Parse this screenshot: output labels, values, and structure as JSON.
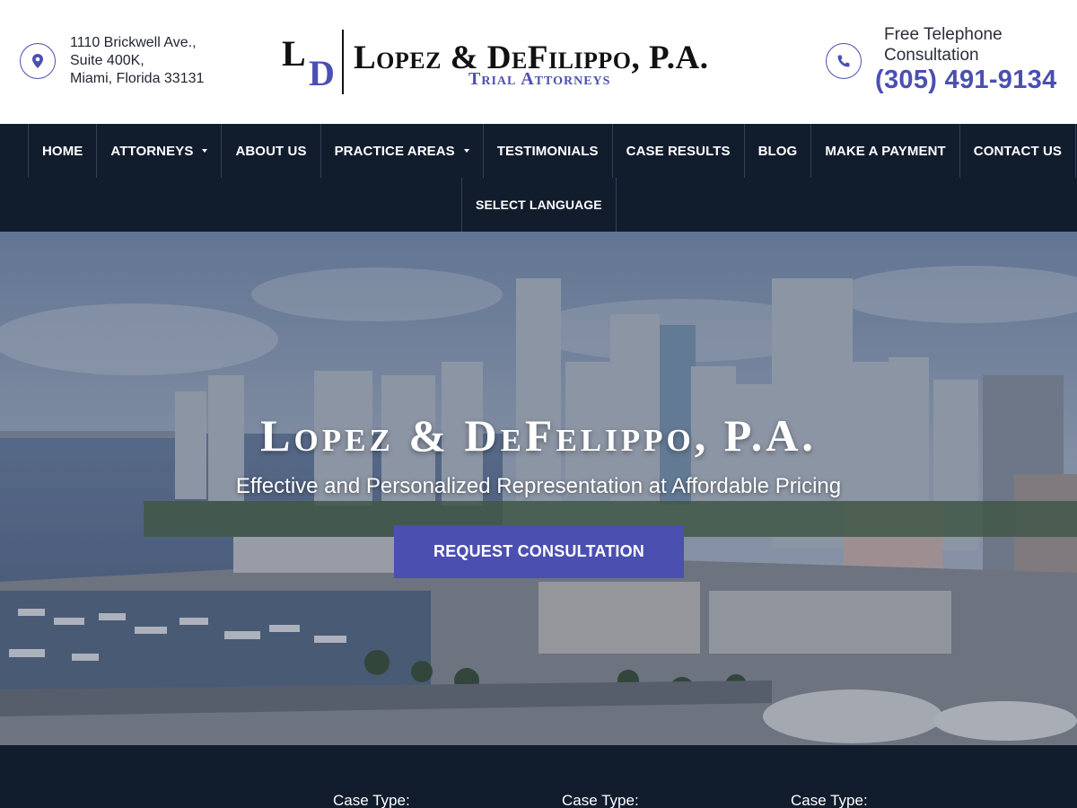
{
  "header": {
    "address": {
      "line1": "1110 Brickwell Ave.,",
      "line2": "Suite 400K,",
      "line3": "Miami, Florida 33131",
      "icon": "location-pin-icon"
    },
    "logo": {
      "monogram_l": "L",
      "monogram_d": "D",
      "name": "Lopez & DeFilippo, P.A.",
      "subtitle": "Trial Attorneys"
    },
    "consultation": {
      "label_line1": "Free Telephone",
      "label_line2": "Consultation",
      "phone": "(305) 491-9134",
      "icon": "phone-icon"
    }
  },
  "nav": {
    "items": [
      {
        "label": "HOME",
        "dropdown": false
      },
      {
        "label": "ATTORNEYS",
        "dropdown": true
      },
      {
        "label": "ABOUT US",
        "dropdown": false
      },
      {
        "label": "PRACTICE AREAS",
        "dropdown": true
      },
      {
        "label": "TESTIMONIALS",
        "dropdown": false
      },
      {
        "label": "CASE RESULTS",
        "dropdown": false
      },
      {
        "label": "BLOG",
        "dropdown": false
      },
      {
        "label": "MAKE A PAYMENT",
        "dropdown": false
      },
      {
        "label": "CONTACT US",
        "dropdown": false
      }
    ],
    "language": "SELECT LANGUAGE"
  },
  "hero": {
    "title": "Lopez & DeFelippo, P.A.",
    "tagline": "Effective and Personalized Representation at Affordable Pricing",
    "cta_label": "REQUEST CONSULTATION"
  },
  "bottom": {
    "case_labels": [
      "Case Type:",
      "Case Type:",
      "Case Type:"
    ]
  },
  "colors": {
    "accent": "#4b4fb0",
    "navy": "#111c2d",
    "white": "#ffffff"
  }
}
